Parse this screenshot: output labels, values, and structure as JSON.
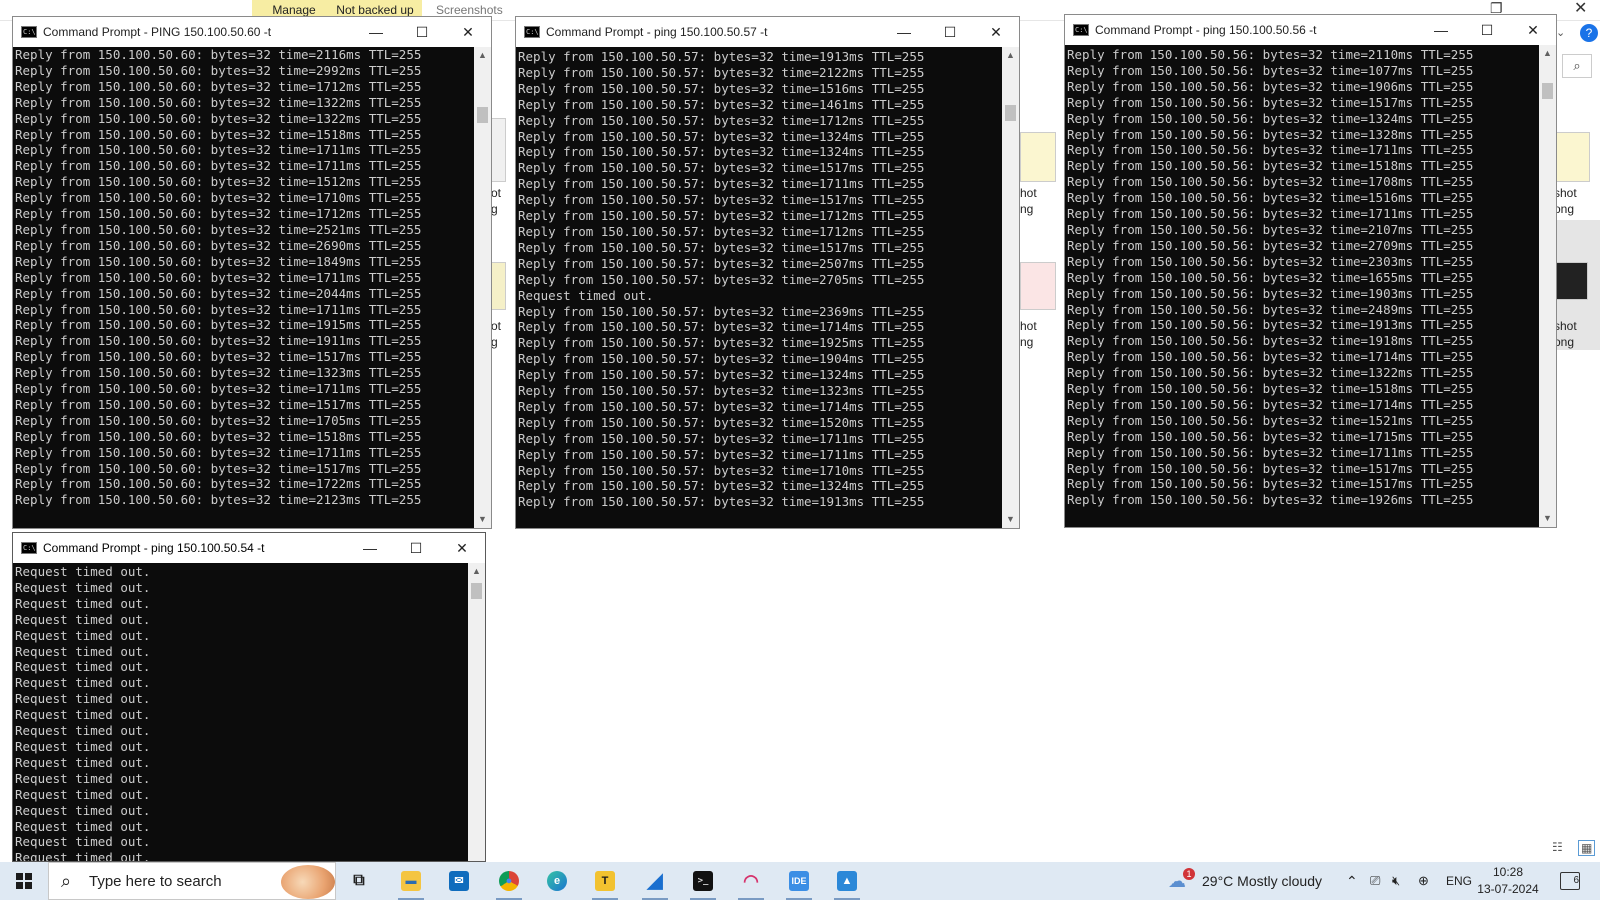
{
  "background": {
    "ribbon_tabs": [
      "Manage",
      "Not backed up",
      "Screenshots"
    ],
    "thumbnail_labels": [
      "ot",
      "g",
      "ot",
      "g",
      "hot",
      "ng",
      "hot",
      "ng",
      "shot",
      "ong",
      "shot",
      "ong"
    ]
  },
  "windows": [
    {
      "id": "ping60",
      "title": "Command Prompt - PING  150.100.50.60 -t",
      "lines": [
        "Reply from 150.100.50.60: bytes=32 time=2116ms TTL=255",
        "Reply from 150.100.50.60: bytes=32 time=2992ms TTL=255",
        "Reply from 150.100.50.60: bytes=32 time=1712ms TTL=255",
        "Reply from 150.100.50.60: bytes=32 time=1322ms TTL=255",
        "Reply from 150.100.50.60: bytes=32 time=1322ms TTL=255",
        "Reply from 150.100.50.60: bytes=32 time=1518ms TTL=255",
        "Reply from 150.100.50.60: bytes=32 time=1711ms TTL=255",
        "Reply from 150.100.50.60: bytes=32 time=1711ms TTL=255",
        "Reply from 150.100.50.60: bytes=32 time=1512ms TTL=255",
        "Reply from 150.100.50.60: bytes=32 time=1710ms TTL=255",
        "Reply from 150.100.50.60: bytes=32 time=1712ms TTL=255",
        "Reply from 150.100.50.60: bytes=32 time=2521ms TTL=255",
        "Reply from 150.100.50.60: bytes=32 time=2690ms TTL=255",
        "Reply from 150.100.50.60: bytes=32 time=1849ms TTL=255",
        "Reply from 150.100.50.60: bytes=32 time=1711ms TTL=255",
        "Reply from 150.100.50.60: bytes=32 time=2044ms TTL=255",
        "Reply from 150.100.50.60: bytes=32 time=1711ms TTL=255",
        "Reply from 150.100.50.60: bytes=32 time=1915ms TTL=255",
        "Reply from 150.100.50.60: bytes=32 time=1911ms TTL=255",
        "Reply from 150.100.50.60: bytes=32 time=1517ms TTL=255",
        "Reply from 150.100.50.60: bytes=32 time=1323ms TTL=255",
        "Reply from 150.100.50.60: bytes=32 time=1711ms TTL=255",
        "Reply from 150.100.50.60: bytes=32 time=1517ms TTL=255",
        "Reply from 150.100.50.60: bytes=32 time=1705ms TTL=255",
        "Reply from 150.100.50.60: bytes=32 time=1518ms TTL=255",
        "Reply from 150.100.50.60: bytes=32 time=1711ms TTL=255",
        "Reply from 150.100.50.60: bytes=32 time=1517ms TTL=255",
        "Reply from 150.100.50.60: bytes=32 time=1722ms TTL=255",
        "Reply from 150.100.50.60: bytes=32 time=2123ms TTL=255"
      ]
    },
    {
      "id": "ping57",
      "title": "Command Prompt - ping  150.100.50.57 -t",
      "lines": [
        "Reply from 150.100.50.57: bytes=32 time=1913ms TTL=255",
        "Reply from 150.100.50.57: bytes=32 time=2122ms TTL=255",
        "Reply from 150.100.50.57: bytes=32 time=1516ms TTL=255",
        "Reply from 150.100.50.57: bytes=32 time=1461ms TTL=255",
        "Reply from 150.100.50.57: bytes=32 time=1712ms TTL=255",
        "Reply from 150.100.50.57: bytes=32 time=1324ms TTL=255",
        "Reply from 150.100.50.57: bytes=32 time=1324ms TTL=255",
        "Reply from 150.100.50.57: bytes=32 time=1517ms TTL=255",
        "Reply from 150.100.50.57: bytes=32 time=1711ms TTL=255",
        "Reply from 150.100.50.57: bytes=32 time=1517ms TTL=255",
        "Reply from 150.100.50.57: bytes=32 time=1712ms TTL=255",
        "Reply from 150.100.50.57: bytes=32 time=1712ms TTL=255",
        "Reply from 150.100.50.57: bytes=32 time=1517ms TTL=255",
        "Reply from 150.100.50.57: bytes=32 time=2507ms TTL=255",
        "Reply from 150.100.50.57: bytes=32 time=2705ms TTL=255",
        "Request timed out.",
        "Reply from 150.100.50.57: bytes=32 time=2369ms TTL=255",
        "Reply from 150.100.50.57: bytes=32 time=1714ms TTL=255",
        "Reply from 150.100.50.57: bytes=32 time=1925ms TTL=255",
        "Reply from 150.100.50.57: bytes=32 time=1904ms TTL=255",
        "Reply from 150.100.50.57: bytes=32 time=1324ms TTL=255",
        "Reply from 150.100.50.57: bytes=32 time=1323ms TTL=255",
        "Reply from 150.100.50.57: bytes=32 time=1714ms TTL=255",
        "Reply from 150.100.50.57: bytes=32 time=1520ms TTL=255",
        "Reply from 150.100.50.57: bytes=32 time=1711ms TTL=255",
        "Reply from 150.100.50.57: bytes=32 time=1711ms TTL=255",
        "Reply from 150.100.50.57: bytes=32 time=1710ms TTL=255",
        "Reply from 150.100.50.57: bytes=32 time=1324ms TTL=255",
        "Reply from 150.100.50.57: bytes=32 time=1913ms TTL=255"
      ]
    },
    {
      "id": "ping56",
      "title": "Command Prompt - ping  150.100.50.56 -t",
      "lines": [
        "Reply from 150.100.50.56: bytes=32 time=2110ms TTL=255",
        "Reply from 150.100.50.56: bytes=32 time=1077ms TTL=255",
        "Reply from 150.100.50.56: bytes=32 time=1906ms TTL=255",
        "Reply from 150.100.50.56: bytes=32 time=1517ms TTL=255",
        "Reply from 150.100.50.56: bytes=32 time=1324ms TTL=255",
        "Reply from 150.100.50.56: bytes=32 time=1328ms TTL=255",
        "Reply from 150.100.50.56: bytes=32 time=1711ms TTL=255",
        "Reply from 150.100.50.56: bytes=32 time=1518ms TTL=255",
        "Reply from 150.100.50.56: bytes=32 time=1708ms TTL=255",
        "Reply from 150.100.50.56: bytes=32 time=1516ms TTL=255",
        "Reply from 150.100.50.56: bytes=32 time=1711ms TTL=255",
        "Reply from 150.100.50.56: bytes=32 time=2107ms TTL=255",
        "Reply from 150.100.50.56: bytes=32 time=2709ms TTL=255",
        "Reply from 150.100.50.56: bytes=32 time=2303ms TTL=255",
        "Reply from 150.100.50.56: bytes=32 time=1655ms TTL=255",
        "Reply from 150.100.50.56: bytes=32 time=1903ms TTL=255",
        "Reply from 150.100.50.56: bytes=32 time=2489ms TTL=255",
        "Reply from 150.100.50.56: bytes=32 time=1913ms TTL=255",
        "Reply from 150.100.50.56: bytes=32 time=1918ms TTL=255",
        "Reply from 150.100.50.56: bytes=32 time=1714ms TTL=255",
        "Reply from 150.100.50.56: bytes=32 time=1322ms TTL=255",
        "Reply from 150.100.50.56: bytes=32 time=1518ms TTL=255",
        "Reply from 150.100.50.56: bytes=32 time=1714ms TTL=255",
        "Reply from 150.100.50.56: bytes=32 time=1521ms TTL=255",
        "Reply from 150.100.50.56: bytes=32 time=1715ms TTL=255",
        "Reply from 150.100.50.56: bytes=32 time=1711ms TTL=255",
        "Reply from 150.100.50.56: bytes=32 time=1517ms TTL=255",
        "Reply from 150.100.50.56: bytes=32 time=1517ms TTL=255",
        "Reply from 150.100.50.56: bytes=32 time=1926ms TTL=255"
      ]
    },
    {
      "id": "ping54",
      "title": "Command Prompt - ping  150.100.50.54 -t",
      "lines": [
        "Request timed out.",
        "Request timed out.",
        "Request timed out.",
        "Request timed out.",
        "Request timed out.",
        "Request timed out.",
        "Request timed out.",
        "Request timed out.",
        "Request timed out.",
        "Request timed out.",
        "Request timed out.",
        "Request timed out.",
        "Request timed out.",
        "Request timed out.",
        "Request timed out.",
        "Request timed out.",
        "Request timed out.",
        "Request timed out.",
        "Request timed out."
      ]
    }
  ],
  "taskbar": {
    "search_placeholder": "Type here to search",
    "apps": [
      {
        "name": "task-view",
        "glyph": "⧉"
      },
      {
        "name": "file-explorer",
        "glyph": "▬"
      },
      {
        "name": "mail",
        "glyph": "✉"
      },
      {
        "name": "chrome",
        "glyph": "●"
      },
      {
        "name": "edge",
        "glyph": "e"
      },
      {
        "name": "t-app",
        "glyph": "T"
      },
      {
        "name": "shark-app",
        "glyph": "◢"
      },
      {
        "name": "command-prompt",
        "glyph": ">_"
      },
      {
        "name": "network-app",
        "glyph": "◠"
      },
      {
        "name": "ide",
        "glyph": "IDE"
      },
      {
        "name": "photos",
        "glyph": "▲"
      }
    ],
    "weather_badge": "1",
    "weather": "29°C  Mostly cloudy",
    "language": "ENG",
    "time": "10:28",
    "date": "13-07-2024",
    "notification_count": "6"
  }
}
